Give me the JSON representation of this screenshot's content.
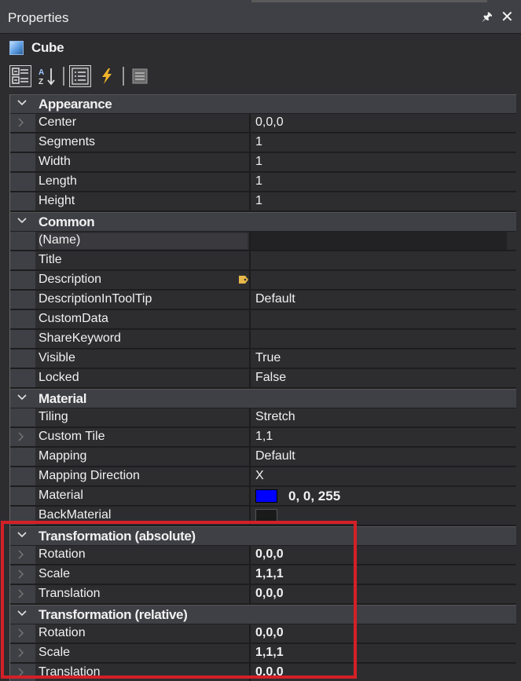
{
  "panel": {
    "title": "Properties"
  },
  "object": {
    "name": "Cube"
  },
  "colors": {
    "highlight": "#d42027",
    "material_swatch": "#0000ff",
    "back_material_swatch": "#1a1a1a"
  },
  "categories": {
    "appearance": "Appearance",
    "common": "Common",
    "material": "Material",
    "transform_abs": "Transformation (absolute)",
    "transform_rel": "Transformation (relative)"
  },
  "appearance": [
    {
      "name": "Center",
      "value": "0,0,0"
    },
    {
      "name": "Segments",
      "value": "1"
    },
    {
      "name": "Width",
      "value": "1"
    },
    {
      "name": "Length",
      "value": "1"
    },
    {
      "name": "Height",
      "value": "1"
    }
  ],
  "common": [
    {
      "name": "(Name)",
      "value": ""
    },
    {
      "name": "Title",
      "value": ""
    },
    {
      "name": "Description",
      "value": ""
    },
    {
      "name": "DescriptionInToolTip",
      "value": "Default"
    },
    {
      "name": "CustomData",
      "value": ""
    },
    {
      "name": "ShareKeyword",
      "value": ""
    },
    {
      "name": "Visible",
      "value": "True"
    },
    {
      "name": "Locked",
      "value": "False"
    }
  ],
  "material": [
    {
      "name": "Tiling",
      "value": "Stretch"
    },
    {
      "name": "Custom Tile",
      "value": "1,1"
    },
    {
      "name": "Mapping",
      "value": "Default"
    },
    {
      "name": "Mapping Direction",
      "value": "X"
    },
    {
      "name": "Material",
      "value": "0, 0, 255"
    },
    {
      "name": "BackMaterial",
      "value": ""
    }
  ],
  "transform_abs": [
    {
      "name": "Rotation",
      "value": "0,0,0"
    },
    {
      "name": "Scale",
      "value": "1,1,1"
    },
    {
      "name": "Translation",
      "value": "0,0,0"
    }
  ],
  "transform_rel": [
    {
      "name": "Rotation",
      "value": "0,0,0"
    },
    {
      "name": "Scale",
      "value": "1,1,1"
    },
    {
      "name": "Translation",
      "value": "0,0,0"
    }
  ]
}
